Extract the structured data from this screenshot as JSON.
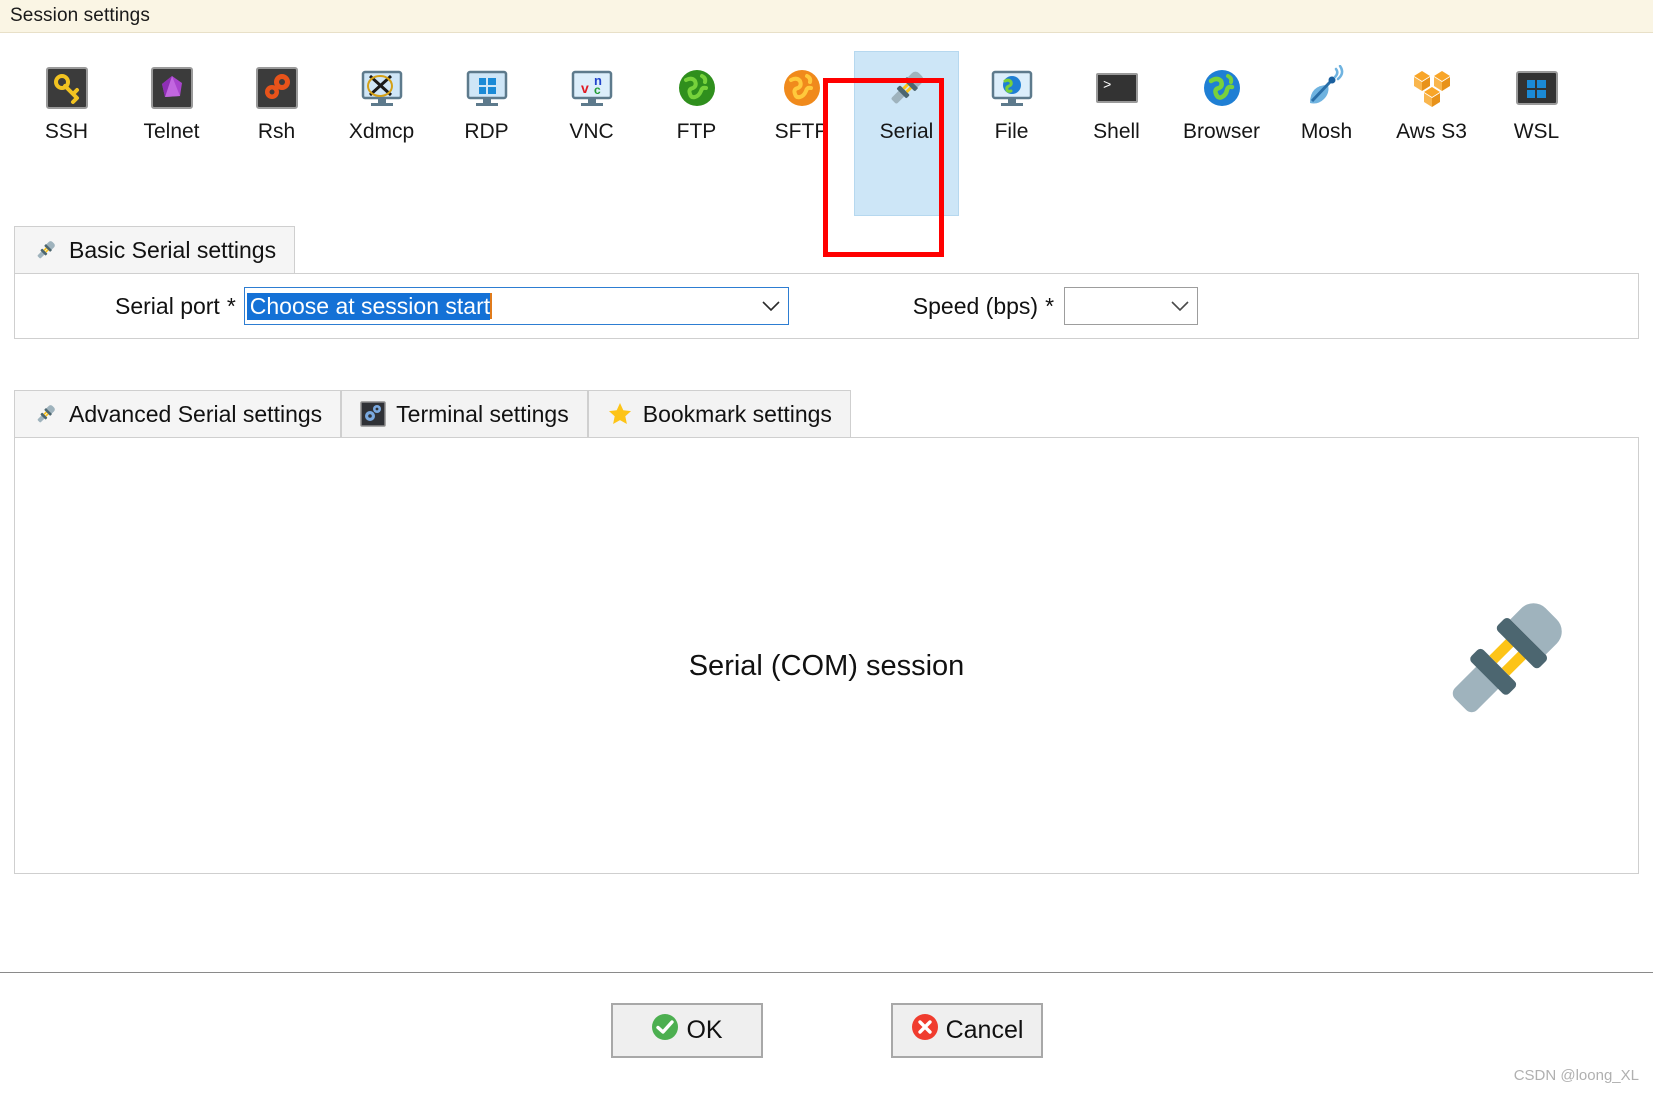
{
  "window": {
    "title": "Session settings",
    "titlebar_color": "#faf5e4"
  },
  "session_types": {
    "selected": "Serial",
    "highlight_color": "#ff0000",
    "selection_color": "#cde6f7",
    "items": [
      {
        "label": "SSH",
        "icon": "key-icon"
      },
      {
        "label": "Telnet",
        "icon": "gem-icon"
      },
      {
        "label": "Rsh",
        "icon": "gears-icon"
      },
      {
        "label": "Xdmcp",
        "icon": "x-monitor-icon"
      },
      {
        "label": "RDP",
        "icon": "windows-monitor-icon"
      },
      {
        "label": "VNC",
        "icon": "vnc-monitor-icon"
      },
      {
        "label": "FTP",
        "icon": "green-globe-icon"
      },
      {
        "label": "SFTP",
        "icon": "orange-globe-icon"
      },
      {
        "label": "Serial",
        "icon": "plug-icon"
      },
      {
        "label": "File",
        "icon": "globe-monitor-icon"
      },
      {
        "label": "Shell",
        "icon": "terminal-prompt-icon"
      },
      {
        "label": "Browser",
        "icon": "blue-globe-icon"
      },
      {
        "label": "Mosh",
        "icon": "satellite-dish-icon"
      },
      {
        "label": "Aws S3",
        "icon": "aws-cubes-icon"
      },
      {
        "label": "WSL",
        "icon": "windows-logo-icon"
      }
    ]
  },
  "basic_tab": {
    "label": "Basic Serial settings",
    "icon": "plug-icon"
  },
  "form": {
    "serial_port": {
      "label": "Serial port",
      "required_marker": "*",
      "value": "Choose at session start",
      "chevron": "chevron-down-icon",
      "focused": true
    },
    "speed": {
      "label": "Speed (bps)",
      "required_marker": "*",
      "value": "",
      "chevron": "chevron-down-icon",
      "focused": false
    }
  },
  "lower_tabs": [
    {
      "label": "Advanced Serial settings",
      "icon": "plug-icon",
      "active": true
    },
    {
      "label": "Terminal settings",
      "icon": "gears-dark-icon",
      "active": false
    },
    {
      "label": "Bookmark settings",
      "icon": "star-icon",
      "active": false
    }
  ],
  "content": {
    "caption": "Serial (COM) session",
    "illustration": "plug-icon"
  },
  "footer": {
    "ok_label": "OK",
    "ok_icon": "check-circle-icon",
    "ok_color": "#4caf50",
    "cancel_label": "Cancel",
    "cancel_icon": "x-circle-icon",
    "cancel_color": "#f03c2e"
  },
  "watermark": "CSDN @loong_XL"
}
